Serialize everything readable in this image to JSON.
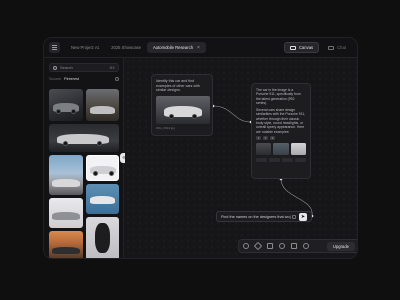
{
  "tabs": [
    {
      "label": "New Project v1"
    },
    {
      "label": "2025 Showcase"
    },
    {
      "label": "Automobile Research",
      "active": true
    }
  ],
  "view_toggle": {
    "canvas": "Canvas",
    "chat": "Chat",
    "selected": "Canvas"
  },
  "sidebar": {
    "search_placeholder": "Search",
    "shortcut": "⌘K",
    "filter_label": "Source",
    "filter_value": "Pinterest"
  },
  "node_request": {
    "text": "Identify this car and find examples of other cars with similar designs.",
    "caption": "IMG_0024.jpg"
  },
  "node_response": {
    "text1": "The car in the image is a Porsche 911, specifically from the latest generation (992 series).",
    "text2": "Several cars share design similarities with the Porsche 911, whether through their classic body style, round headlights, or overall sporty appearance. Here are notable examples:",
    "pills": [
      "1",
      "2",
      "3"
    ]
  },
  "prompt": {
    "value": "Find the names on the designers that wo|"
  },
  "toolbar": {
    "upgrade_label": "Upgrade"
  },
  "colors": {
    "background": "#0f0f10",
    "panel": "#161618",
    "accent": "#e8e8ea"
  }
}
